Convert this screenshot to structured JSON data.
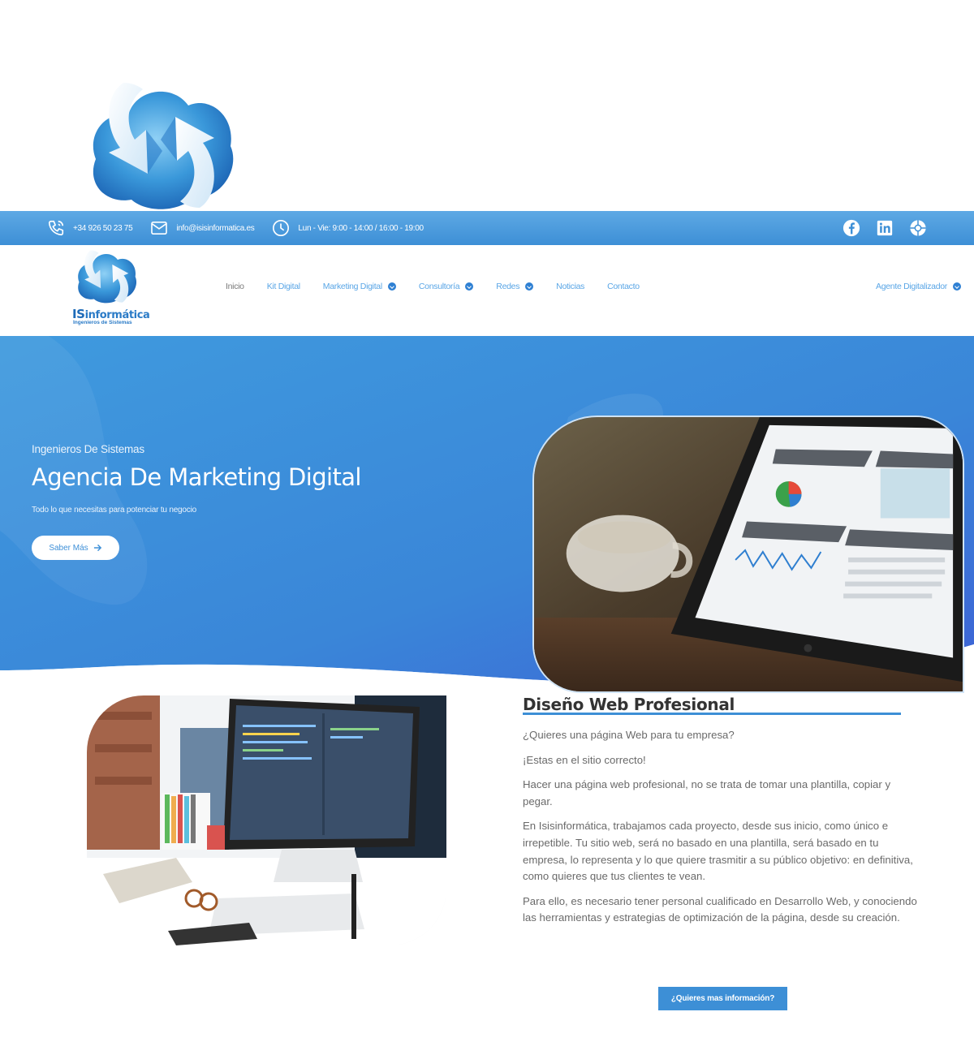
{
  "brand": {
    "name_is": "IS",
    "name_rest": "informática",
    "tagline": "Ingenieros de Sistemas",
    "logo_icon": "cloud-arrows-logo"
  },
  "topbar": {
    "phone": "+34 926 50 23 75",
    "email": "info@isisinformatica.es",
    "hours": "Lun - Vie: 9:00 - 14:00 / 16:00 - 19:00",
    "icons": [
      "phone-icon",
      "mail-icon",
      "clock-icon",
      "facebook-icon",
      "linkedin-icon",
      "dribbble-icon"
    ]
  },
  "nav": {
    "items": [
      {
        "label": "Inicio",
        "dropdown": false
      },
      {
        "label": "Kit Digital",
        "dropdown": false
      },
      {
        "label": "Marketing Digital",
        "dropdown": true
      },
      {
        "label": "Consultoría",
        "dropdown": true
      },
      {
        "label": "Redes",
        "dropdown": true
      },
      {
        "label": "Noticias",
        "dropdown": false
      },
      {
        "label": "Contacto",
        "dropdown": false
      }
    ],
    "right_item": "Agente Digitalizador"
  },
  "hero": {
    "eyebrow": "Ingenieros De Sistemas",
    "title": "Agencia De Marketing Digital",
    "subtitle": "Todo lo que necesitas para potenciar tu negocio",
    "button": "Saber Más"
  },
  "section": {
    "title": "Diseño Web Profesional",
    "paragraphs": [
      "¿Quieres una página Web para tu empresa?",
      "¡Estas en el sitio correcto!",
      "Hacer una página web profesional, no se trata de tomar una plantilla, copiar y pegar.",
      "En Isisinformática, trabajamos cada proyecto, desde sus inicio, como único e irrepetible. Tu sitio web, será no basado en una plantilla, será basado en tu empresa, lo  representa y lo que quiere trasmitir a su público objetivo: en definitiva, como quieres que tus clientes te vean.",
      "Para ello, es necesario tener personal cualificado en Desarrollo Web,  y conociendo las herramientas y estrategias de optimización de la página, desde su creación."
    ],
    "cta": "¿Quieres mas información?"
  },
  "colors": {
    "primary": "#3d8fd6",
    "hero_top": "#3a8fdc",
    "hero_bottom": "#3f6fdc",
    "nav_text": "#5aa6e6"
  }
}
